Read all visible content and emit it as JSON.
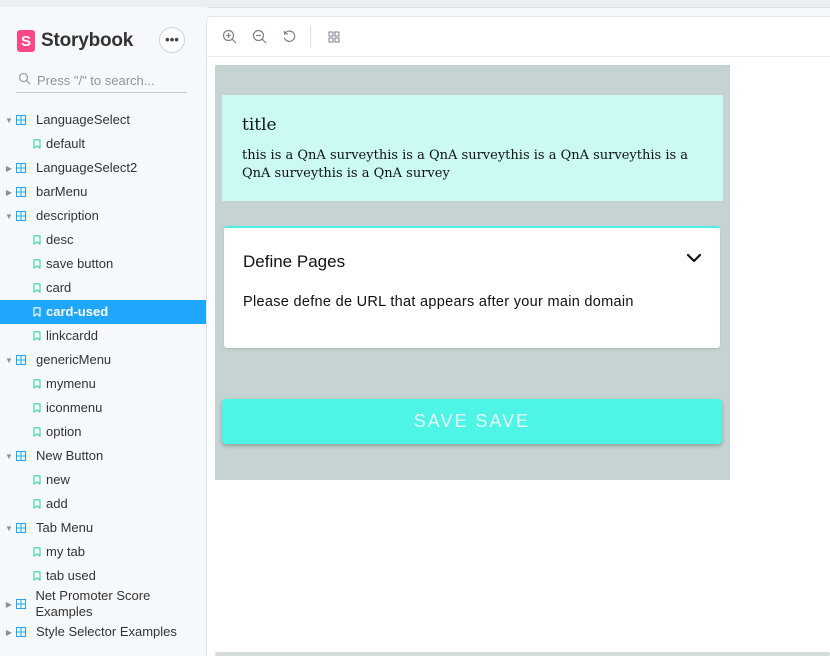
{
  "app": {
    "name": "Storybook",
    "logo_letter": "S"
  },
  "search": {
    "placeholder": "Press \"/\" to search..."
  },
  "sidebar": {
    "items": [
      {
        "kind": "group",
        "label": "LanguageSelect",
        "expanded": true
      },
      {
        "kind": "story",
        "label": "default"
      },
      {
        "kind": "group",
        "label": "LanguageSelect2",
        "expanded": false
      },
      {
        "kind": "group",
        "label": "barMenu",
        "expanded": false
      },
      {
        "kind": "group",
        "label": "description",
        "expanded": true
      },
      {
        "kind": "story",
        "label": "desc"
      },
      {
        "kind": "story",
        "label": "save button"
      },
      {
        "kind": "story",
        "label": "card"
      },
      {
        "kind": "story",
        "label": "card-used",
        "selected": true
      },
      {
        "kind": "story",
        "label": "linkcardd"
      },
      {
        "kind": "group",
        "label": "genericMenu",
        "expanded": true
      },
      {
        "kind": "story",
        "label": "mymenu"
      },
      {
        "kind": "story",
        "label": "iconmenu"
      },
      {
        "kind": "story",
        "label": "option"
      },
      {
        "kind": "group",
        "label": "New Button",
        "expanded": true
      },
      {
        "kind": "story",
        "label": "new"
      },
      {
        "kind": "story",
        "label": "add"
      },
      {
        "kind": "group",
        "label": "Tab Menu",
        "expanded": true
      },
      {
        "kind": "story",
        "label": "my tab"
      },
      {
        "kind": "story",
        "label": "tab used"
      },
      {
        "kind": "group",
        "label": "Net Promoter Score Examples",
        "expanded": false,
        "tall": true
      },
      {
        "kind": "group",
        "label": "Style Selector Examples",
        "expanded": false
      }
    ]
  },
  "toolbar": {
    "icons": [
      "zoom-in-icon",
      "zoom-out-icon",
      "zoom-reset-icon",
      "grid-icon"
    ]
  },
  "preview": {
    "qna": {
      "title": "title",
      "body": "this is a QnA surveythis is a QnA surveythis is a QnA surveythis is a QnA surveythis is a QnA survey"
    },
    "define_pages": {
      "title": "Define Pages",
      "description": "Please defne de URL that appears after your main domain"
    },
    "save_button": {
      "label": "SAVE SAVE"
    }
  },
  "colors": {
    "accent": "#1ea7fd",
    "brand": "#ff4785",
    "story_icon": "#37d5a6",
    "canvas_bg": "#c5d3d3",
    "qna_bg": "#cbfaf4",
    "save_button_bg": "#4ef5e6"
  }
}
